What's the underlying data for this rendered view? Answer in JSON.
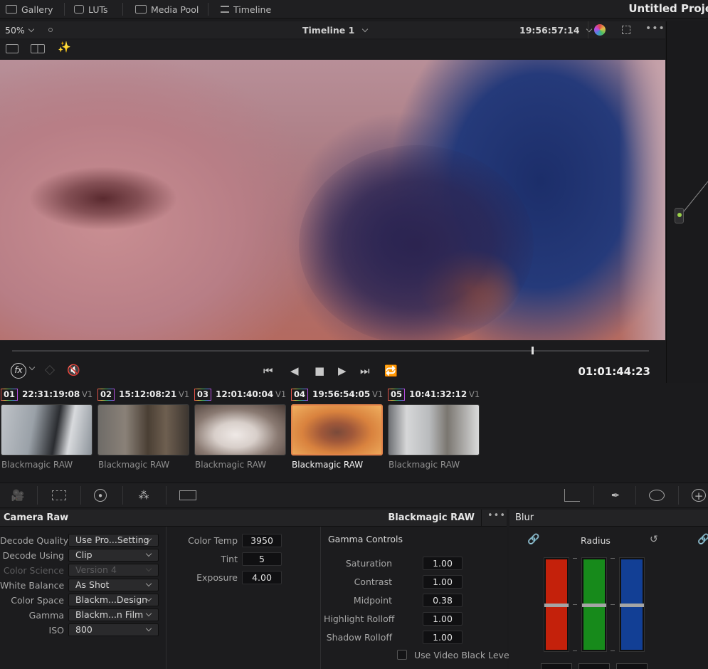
{
  "topbar": {
    "tabs": [
      {
        "label": "Gallery",
        "icon": "gallery-icon"
      },
      {
        "label": "LUTs",
        "icon": "luts-icon"
      },
      {
        "label": "Media Pool",
        "icon": "media-pool-icon"
      },
      {
        "label": "Timeline",
        "icon": "timeline-icon"
      }
    ],
    "project_title": "Untitled Proje"
  },
  "viewer": {
    "zoom": "50%",
    "timeline_name": "Timeline 1",
    "timecode": "19:56:57:14",
    "playhead_timecode": "01:01:44:23",
    "playhead_position_percent": 81
  },
  "clips": [
    {
      "num": "01",
      "timecode": "22:31:19:08",
      "track": "V1",
      "name": "Blackmagic RAW",
      "selected": false
    },
    {
      "num": "02",
      "timecode": "15:12:08:21",
      "track": "V1",
      "name": "Blackmagic RAW",
      "selected": false
    },
    {
      "num": "03",
      "timecode": "12:01:40:04",
      "track": "V1",
      "name": "Blackmagic RAW",
      "selected": false
    },
    {
      "num": "04",
      "timecode": "19:56:54:05",
      "track": "V1",
      "name": "Blackmagic RAW",
      "selected": true
    },
    {
      "num": "05",
      "timecode": "10:41:32:12",
      "track": "V1",
      "name": "Blackmagic RAW",
      "selected": false
    }
  ],
  "camera_raw": {
    "title": "Camera Raw",
    "source": "Blackmagic RAW",
    "decode": [
      {
        "label": "Decode Quality",
        "value": "Use Pro...Setting",
        "enabled": true
      },
      {
        "label": "Decode Using",
        "value": "Clip",
        "enabled": true
      },
      {
        "label": "Color Science",
        "value": "Version 4",
        "enabled": false
      },
      {
        "label": "White Balance",
        "value": "As Shot",
        "enabled": true
      },
      {
        "label": "Color Space",
        "value": "Blackm...Design",
        "enabled": true
      },
      {
        "label": "Gamma",
        "value": "Blackm...n Film",
        "enabled": true
      },
      {
        "label": "ISO",
        "value": "800",
        "enabled": true
      }
    ],
    "color": [
      {
        "label": "Color Temp",
        "value": "3950"
      },
      {
        "label": "Tint",
        "value": "5"
      },
      {
        "label": "Exposure",
        "value": "4.00"
      }
    ],
    "gamma_controls": {
      "title": "Gamma Controls",
      "fields": [
        {
          "label": "Saturation",
          "value": "1.00"
        },
        {
          "label": "Contrast",
          "value": "1.00"
        },
        {
          "label": "Midpoint",
          "value": "0.38"
        },
        {
          "label": "Highlight Rolloff",
          "value": "1.00"
        },
        {
          "label": "Shadow Rolloff",
          "value": "1.00"
        }
      ],
      "video_black_label": "Use Video Black Level",
      "video_black_checked": false
    }
  },
  "blur": {
    "title": "Blur",
    "radius_label": "Radius",
    "channels": [
      {
        "color": "#c4210b"
      },
      {
        "color": "#178a1b"
      },
      {
        "color": "#123f95"
      }
    ]
  },
  "colors": {
    "accent": "#e2834a",
    "mute": "#e04040",
    "node_green": "#9bd24a"
  }
}
